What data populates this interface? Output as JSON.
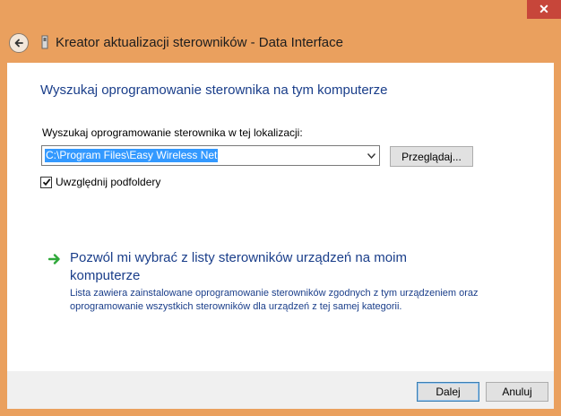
{
  "window": {
    "title": "Kreator aktualizacji sterowników - Data Interface",
    "close_glyph": "✕"
  },
  "page": {
    "heading": "Wyszukaj oprogramowanie sterownika na tym komputerze",
    "search_label": "Wyszukaj oprogramowanie sterownika w tej lokalizacji:",
    "path_value": "C:\\Program Files\\Easy Wireless Net",
    "browse_label": "Przeglądaj...",
    "include_subfolders_label": "Uwzględnij podfoldery",
    "include_subfolders_checked": true,
    "pick_option": {
      "title": "Pozwól mi wybrać z listy sterowników urządzeń na moim komputerze",
      "description": "Lista zawiera zainstalowane oprogramowanie sterowników zgodnych z tym urządzeniem oraz oprogramowanie wszystkich sterowników dla urządzeń z tej samej kategorii."
    }
  },
  "footer": {
    "next_label": "Dalej",
    "cancel_label": "Anuluj"
  },
  "colors": {
    "frame": "#eaa05e",
    "accent_text": "#1a3e8a",
    "selection": "#3399ff",
    "arrow_green": "#2fa83a"
  }
}
